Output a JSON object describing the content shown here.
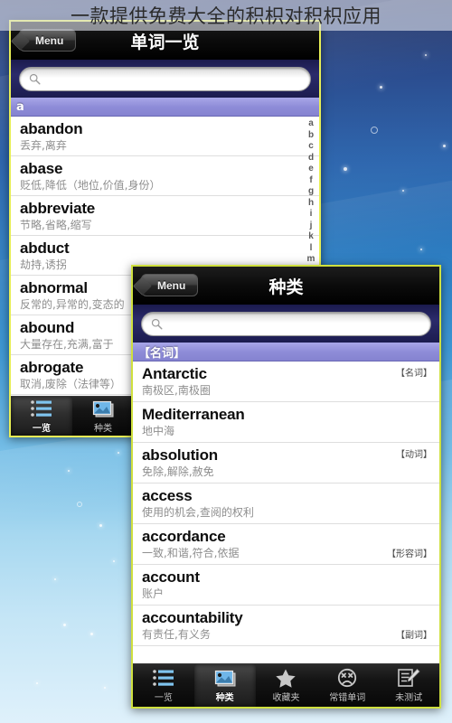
{
  "banner": {
    "text": "一款提供免费大全的积枳对积枳应用"
  },
  "colors": {
    "frame_border": "#e8ef55",
    "section_header": "#8f8dd8",
    "searchbar_bg": "#2b2b6b",
    "tabbar_bg": "#151515",
    "background_top": "#16275c",
    "background_bottom": "#dff1fb"
  },
  "phone_one": {
    "nav": {
      "menu_label": "Menu",
      "title": "单词一览"
    },
    "search": {
      "placeholder": "",
      "icon": "search-icon"
    },
    "section_header": "a",
    "index_letters": [
      "a",
      "b",
      "c",
      "d",
      "e",
      "f",
      "g",
      "h",
      "i",
      "j",
      "k",
      "l",
      "m"
    ],
    "rows": [
      {
        "word": "abandon",
        "definition": "丢弃,离弃"
      },
      {
        "word": "abase",
        "definition": "贬低,降低（地位,价值,身份）"
      },
      {
        "word": "abbreviate",
        "definition": "节略,省略,缩写"
      },
      {
        "word": "abduct",
        "definition": "劫持,诱拐"
      },
      {
        "word": "abnormal",
        "definition": "反常的,异常的,变态的"
      },
      {
        "word": "abound",
        "definition": "大量存在,充满,富于"
      },
      {
        "word": "abrogate",
        "definition": "取消,废除（法律等）"
      }
    ],
    "tabs": [
      {
        "label": "一览",
        "icon": "list-icon",
        "selected": true
      },
      {
        "label": "种类",
        "icon": "cards-icon",
        "selected": false
      }
    ]
  },
  "phone_two": {
    "nav": {
      "menu_label": "Menu",
      "title": "种类"
    },
    "search": {
      "placeholder": "",
      "icon": "search-icon"
    },
    "section_header": "【名词】",
    "rows": [
      {
        "word": "Antarctic",
        "definition": "南极区,南极圈",
        "tag": "【名词】",
        "tag_low": false
      },
      {
        "word": "Mediterranean",
        "definition": "地中海",
        "tag": "",
        "tag_low": false
      },
      {
        "word": "absolution",
        "definition": "免除,解除,赦免",
        "tag": "【动词】",
        "tag_low": false
      },
      {
        "word": "access",
        "definition": "使用的机会,查阅的权利",
        "tag": "",
        "tag_low": false
      },
      {
        "word": "accordance",
        "definition": "一致,和谐,符合,依据",
        "tag": "【形容词】",
        "tag_low": true
      },
      {
        "word": "account",
        "definition": "账户",
        "tag": "",
        "tag_low": false
      },
      {
        "word": "accountability",
        "definition": "有责任,有义务",
        "tag": "【副词】",
        "tag_low": true
      }
    ],
    "tabs": [
      {
        "label": "一览",
        "icon": "list-icon",
        "selected": false
      },
      {
        "label": "种类",
        "icon": "cards-icon",
        "selected": true
      },
      {
        "label": "收藏夹",
        "icon": "star-icon",
        "selected": false
      },
      {
        "label": "常错单词",
        "icon": "sad-face-icon",
        "selected": false
      },
      {
        "label": "未测试",
        "icon": "test-pen-icon",
        "selected": false
      }
    ]
  }
}
